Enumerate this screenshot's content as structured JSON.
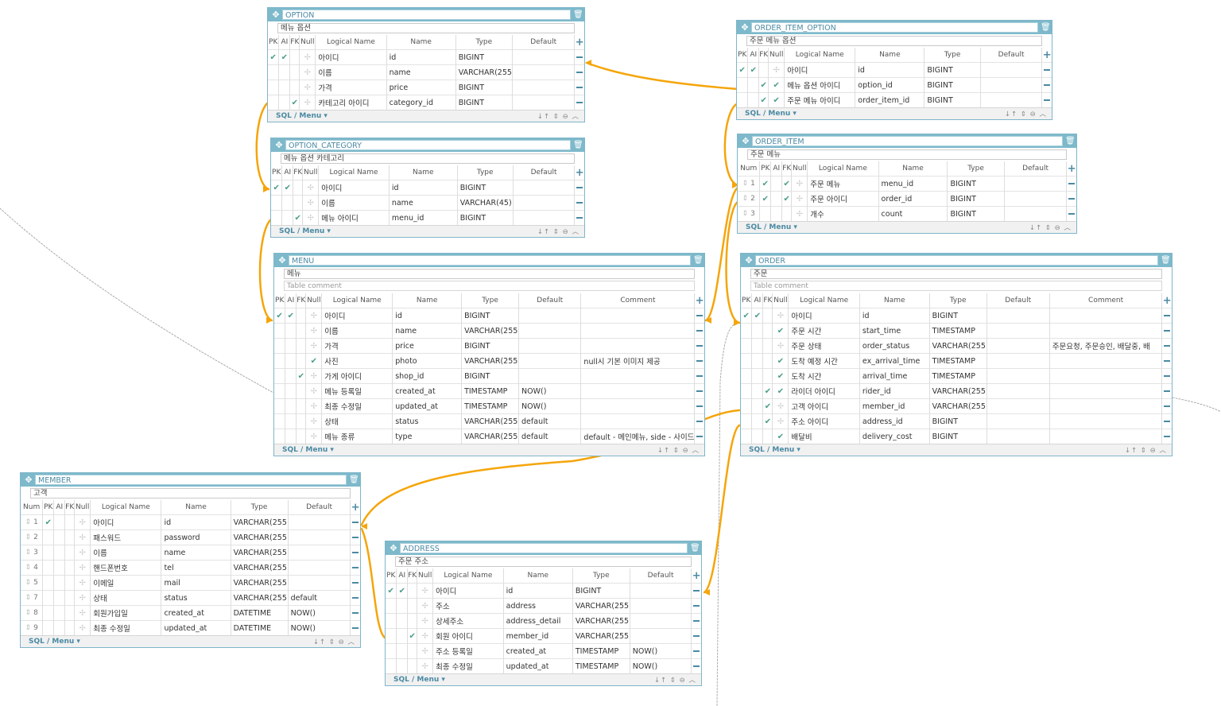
{
  "ui": {
    "sql_menu": "SQL / Menu  ▾",
    "foot_icons": "↓↑ ⇕ ⊖ ︿",
    "move_icon": "✥",
    "delete_icon": "🗑",
    "check": "✔",
    "off": "✢",
    "sort": "⇕"
  },
  "tables": [
    {
      "id": "option",
      "name": "OPTION",
      "logical": "메뉴 옵션",
      "comment": null,
      "num": false,
      "columns": [
        "PK",
        "AI",
        "FK",
        "Null",
        "Logical Name",
        "Name",
        "Type",
        "Default"
      ],
      "rows": [
        {
          "pk": true,
          "ai": true,
          "fk": false,
          "nn": false,
          "logical": "아이디",
          "name": "id",
          "type": "BIGINT",
          "default": ""
        },
        {
          "pk": false,
          "ai": false,
          "fk": false,
          "nn": false,
          "logical": "이름",
          "name": "name",
          "type": "VARCHAR(255",
          "default": ""
        },
        {
          "pk": false,
          "ai": false,
          "fk": false,
          "nn": false,
          "logical": "가격",
          "name": "price",
          "type": "BIGINT",
          "default": ""
        },
        {
          "pk": false,
          "ai": false,
          "fk": true,
          "nn": false,
          "logical": "카테고리 아이디",
          "name": "category_id",
          "type": "BIGINT",
          "default": ""
        }
      ]
    },
    {
      "id": "option_category",
      "name": "OPTION_CATEGORY",
      "logical": "메뉴 옵션 카테고리",
      "comment": null,
      "num": false,
      "columns": [
        "PK",
        "AI",
        "FK",
        "Null",
        "Logical Name",
        "Name",
        "Type",
        "Default"
      ],
      "rows": [
        {
          "pk": true,
          "ai": true,
          "fk": false,
          "nn": false,
          "logical": "아이디",
          "name": "id",
          "type": "BIGINT",
          "default": ""
        },
        {
          "pk": false,
          "ai": false,
          "fk": false,
          "nn": false,
          "logical": "이름",
          "name": "name",
          "type": "VARCHAR(45)",
          "default": ""
        },
        {
          "pk": false,
          "ai": false,
          "fk": true,
          "nn": false,
          "logical": "메뉴 아이디",
          "name": "menu_id",
          "type": "BIGINT",
          "default": ""
        }
      ]
    },
    {
      "id": "menu",
      "name": "MENU",
      "logical": "메뉴",
      "comment": "Table comment",
      "num": false,
      "columns": [
        "PK",
        "AI",
        "FK",
        "Null",
        "Logical Name",
        "Name",
        "Type",
        "Default",
        "Comment"
      ],
      "rows": [
        {
          "pk": true,
          "ai": true,
          "fk": false,
          "nn": false,
          "logical": "아이디",
          "name": "id",
          "type": "BIGINT",
          "default": "",
          "comment": ""
        },
        {
          "pk": false,
          "ai": false,
          "fk": false,
          "nn": false,
          "logical": "이름",
          "name": "name",
          "type": "VARCHAR(255",
          "default": "",
          "comment": ""
        },
        {
          "pk": false,
          "ai": false,
          "fk": false,
          "nn": false,
          "logical": "가격",
          "name": "price",
          "type": "BIGINT",
          "default": "",
          "comment": ""
        },
        {
          "pk": false,
          "ai": false,
          "fk": false,
          "nn": true,
          "logical": "사진",
          "name": "photo",
          "type": "VARCHAR(255",
          "default": "",
          "comment": "null시 기본 이미지 제공"
        },
        {
          "pk": false,
          "ai": false,
          "fk": true,
          "nn": false,
          "logical": "가게 아이디",
          "name": "shop_id",
          "type": "BIGINT",
          "default": "",
          "comment": ""
        },
        {
          "pk": false,
          "ai": false,
          "fk": false,
          "nn": false,
          "logical": "메뉴 등록일",
          "name": "created_at",
          "type": "TIMESTAMP",
          "default": "NOW()",
          "comment": ""
        },
        {
          "pk": false,
          "ai": false,
          "fk": false,
          "nn": false,
          "logical": "최종 수정일",
          "name": "updated_at",
          "type": "TIMESTAMP",
          "default": "NOW()",
          "comment": ""
        },
        {
          "pk": false,
          "ai": false,
          "fk": false,
          "nn": false,
          "logical": "상태",
          "name": "status",
          "type": "VARCHAR(255",
          "default": "default",
          "comment": ""
        },
        {
          "pk": false,
          "ai": false,
          "fk": false,
          "nn": false,
          "logical": "메뉴 종류",
          "name": "type",
          "type": "VARCHAR(255",
          "default": "default",
          "comment": "default - 메인메뉴, side - 사이드"
        }
      ]
    },
    {
      "id": "order_item_option",
      "name": "ORDER_ITEM_OPTION",
      "logical": "주문 메뉴 옵션",
      "comment": null,
      "num": false,
      "columns": [
        "PK",
        "AI",
        "FK",
        "Null",
        "Logical Name",
        "Name",
        "Type",
        "Default"
      ],
      "rows": [
        {
          "pk": true,
          "ai": true,
          "fk": false,
          "nn": false,
          "logical": "아이디",
          "name": "id",
          "type": "BIGINT",
          "default": ""
        },
        {
          "pk": false,
          "ai": false,
          "fk": true,
          "nn": true,
          "logical": "메뉴 옵션 아이디",
          "name": "option_id",
          "type": "BIGINT",
          "default": ""
        },
        {
          "pk": false,
          "ai": false,
          "fk": true,
          "nn": true,
          "logical": "주문 메뉴 아이디",
          "name": "order_item_id",
          "type": "BIGINT",
          "default": ""
        }
      ]
    },
    {
      "id": "order_item",
      "name": "ORDER_ITEM",
      "logical": "주문 메뉴",
      "comment": null,
      "num": true,
      "columns": [
        "Num",
        "PK",
        "AI",
        "FK",
        "Null",
        "Logical Name",
        "Name",
        "Type",
        "Default"
      ],
      "rows": [
        {
          "num": "1",
          "pk": true,
          "ai": false,
          "fk": true,
          "nn": false,
          "logical": "주문 메뉴",
          "name": "menu_id",
          "type": "BIGINT",
          "default": ""
        },
        {
          "num": "2",
          "pk": true,
          "ai": false,
          "fk": true,
          "nn": false,
          "logical": "주문 아이디",
          "name": "order_id",
          "type": "BIGINT",
          "default": ""
        },
        {
          "num": "3",
          "pk": false,
          "ai": false,
          "fk": false,
          "nn": false,
          "logical": "개수",
          "name": "count",
          "type": "BIGINT",
          "default": ""
        }
      ]
    },
    {
      "id": "order",
      "name": "ORDER",
      "logical": "주문",
      "comment": "Table comment",
      "num": false,
      "columns": [
        "PK",
        "AI",
        "FK",
        "Null",
        "Logical Name",
        "Name",
        "Type",
        "Default",
        "Comment"
      ],
      "rows": [
        {
          "pk": true,
          "ai": true,
          "fk": false,
          "nn": false,
          "logical": "아이디",
          "name": "id",
          "type": "BIGINT",
          "default": "",
          "comment": ""
        },
        {
          "pk": false,
          "ai": false,
          "fk": false,
          "nn": true,
          "logical": "주문 시간",
          "name": "start_time",
          "type": "TIMESTAMP",
          "default": "",
          "comment": ""
        },
        {
          "pk": false,
          "ai": false,
          "fk": false,
          "nn": false,
          "logical": "주문 상태",
          "name": "order_status",
          "type": "VARCHAR(255",
          "default": "",
          "comment": "주문요청, 주문승인, 배달중, 배"
        },
        {
          "pk": false,
          "ai": false,
          "fk": false,
          "nn": true,
          "logical": "도착 예정 시간",
          "name": "ex_arrival_time",
          "type": "TIMESTAMP",
          "default": "",
          "comment": ""
        },
        {
          "pk": false,
          "ai": false,
          "fk": false,
          "nn": true,
          "logical": "도착 시간",
          "name": "arrival_time",
          "type": "TIMESTAMP",
          "default": "",
          "comment": ""
        },
        {
          "pk": false,
          "ai": false,
          "fk": true,
          "nn": true,
          "logical": "라이더 아이디",
          "name": "rider_id",
          "type": "VARCHAR(255",
          "default": "",
          "comment": ""
        },
        {
          "pk": false,
          "ai": false,
          "fk": true,
          "nn": false,
          "logical": "고객 아이디",
          "name": "member_id",
          "type": "VARCHAR(255",
          "default": "",
          "comment": ""
        },
        {
          "pk": false,
          "ai": false,
          "fk": true,
          "nn": false,
          "logical": "주소 아이디",
          "name": "address_id",
          "type": "BIGINT",
          "default": "",
          "comment": ""
        },
        {
          "pk": false,
          "ai": false,
          "fk": false,
          "nn": true,
          "logical": "배달비",
          "name": "delivery_cost",
          "type": "BIGINT",
          "default": "",
          "comment": ""
        }
      ]
    },
    {
      "id": "member",
      "name": "MEMBER",
      "logical": "고객",
      "comment": null,
      "num": true,
      "columns": [
        "Num",
        "PK",
        "AI",
        "FK",
        "Null",
        "Logical Name",
        "Name",
        "Type",
        "Default"
      ],
      "rows": [
        {
          "num": "1",
          "pk": true,
          "ai": false,
          "fk": false,
          "nn": false,
          "logical": "아이디",
          "name": "id",
          "type": "VARCHAR(255",
          "default": ""
        },
        {
          "num": "2",
          "pk": false,
          "ai": false,
          "fk": false,
          "nn": false,
          "logical": "패스워드",
          "name": "password",
          "type": "VARCHAR(255",
          "default": ""
        },
        {
          "num": "3",
          "pk": false,
          "ai": false,
          "fk": false,
          "nn": false,
          "logical": "이름",
          "name": "name",
          "type": "VARCHAR(255",
          "default": ""
        },
        {
          "num": "4",
          "pk": false,
          "ai": false,
          "fk": false,
          "nn": false,
          "logical": "핸드폰번호",
          "name": "tel",
          "type": "VARCHAR(255",
          "default": ""
        },
        {
          "num": "5",
          "pk": false,
          "ai": false,
          "fk": false,
          "nn": false,
          "logical": "이메일",
          "name": "mail",
          "type": "VARCHAR(255",
          "default": ""
        },
        {
          "num": "7",
          "pk": false,
          "ai": false,
          "fk": false,
          "nn": false,
          "logical": "상태",
          "name": "status",
          "type": "VARCHAR(255",
          "default": "default"
        },
        {
          "num": "8",
          "pk": false,
          "ai": false,
          "fk": false,
          "nn": false,
          "logical": "회원가입일",
          "name": "created_at",
          "type": "DATETIME",
          "default": "NOW()"
        },
        {
          "num": "9",
          "pk": false,
          "ai": false,
          "fk": false,
          "nn": false,
          "logical": "최종 수정일",
          "name": "updated_at",
          "type": "DATETIME",
          "default": "NOW()"
        }
      ]
    },
    {
      "id": "address",
      "name": "ADDRESS",
      "logical": "주문 주소",
      "comment": null,
      "num": false,
      "columns": [
        "PK",
        "AI",
        "FK",
        "Null",
        "Logical Name",
        "Name",
        "Type",
        "Default"
      ],
      "rows": [
        {
          "pk": true,
          "ai": true,
          "fk": false,
          "nn": false,
          "logical": "아이디",
          "name": "id",
          "type": "BIGINT",
          "default": ""
        },
        {
          "pk": false,
          "ai": false,
          "fk": false,
          "nn": false,
          "logical": "주소",
          "name": "address",
          "type": "VARCHAR(255",
          "default": ""
        },
        {
          "pk": false,
          "ai": false,
          "fk": false,
          "nn": false,
          "logical": "상세주소",
          "name": "address_detail",
          "type": "VARCHAR(255",
          "default": ""
        },
        {
          "pk": false,
          "ai": false,
          "fk": true,
          "nn": false,
          "logical": "회원 아이디",
          "name": "member_id",
          "type": "VARCHAR(255",
          "default": ""
        },
        {
          "pk": false,
          "ai": false,
          "fk": false,
          "nn": false,
          "logical": "주소 등록일",
          "name": "created_at",
          "type": "TIMESTAMP",
          "default": "NOW()"
        },
        {
          "pk": false,
          "ai": false,
          "fk": false,
          "nn": false,
          "logical": "최종 수정일",
          "name": "updated_at",
          "type": "TIMESTAMP",
          "default": "NOW()"
        }
      ]
    }
  ]
}
